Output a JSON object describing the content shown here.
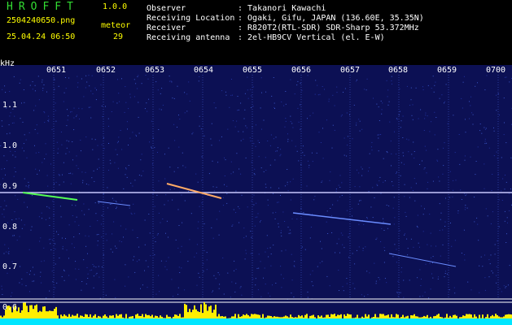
{
  "header": {
    "app_name": "HROFFT",
    "version": "1.0.0",
    "filename": "2504240650.png",
    "meteor_label": "meteor",
    "datetime": "25.04.24 06:50",
    "meteor_count": "29",
    "fields": [
      {
        "label": "Observer",
        "value": ": Takanori Kawachi"
      },
      {
        "label": "Receiving Location",
        "value": ": Ogaki, Gifu, JAPAN (136.60E, 35.35N)"
      },
      {
        "label": "Receiver",
        "value": ": R820T2(RTL-SDR) SDR-Sharp 53.372MHz"
      },
      {
        "label": "Receiving antenna",
        "value": ": 2el-HB9CV Vertical (el. E-W)"
      }
    ]
  },
  "spectrogram": {
    "y_unit": "kHz",
    "y_ticks": [
      "1.1",
      "1.0",
      "0.9",
      "0.8",
      "0.7",
      "0.6"
    ],
    "x_ticks": [
      "0651",
      "0652",
      "0653",
      "0654",
      "0655",
      "0656",
      "0657",
      "0658",
      "0659",
      "0700"
    ],
    "colors": {
      "background": "#0c1054",
      "carrier": "#c8c8ff",
      "meteor_trail": "#6a8cff",
      "activity_bar": "#ffee00",
      "activity_base": "#00e6ff"
    }
  }
}
